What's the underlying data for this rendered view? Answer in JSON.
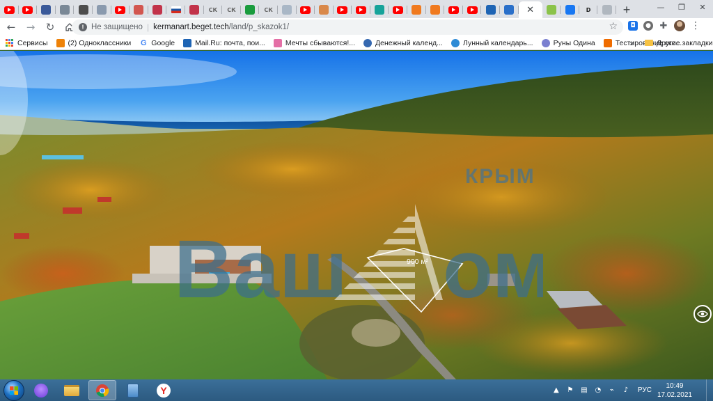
{
  "browser": {
    "tabs": [
      {
        "icon": "youtube-icon",
        "kind": "yt"
      },
      {
        "icon": "youtube-icon",
        "kind": "yt"
      },
      {
        "icon": "square-blue-icon",
        "kind": "sq",
        "color": "#3b5a9a"
      },
      {
        "icon": "mountain-icon",
        "kind": "sq",
        "color": "#7a8896"
      },
      {
        "icon": "image-icon",
        "kind": "sq",
        "color": "#4d4d4d"
      },
      {
        "icon": "link-icon",
        "kind": "sq",
        "color": "#8a9aae"
      },
      {
        "icon": "youtube-icon",
        "kind": "yt"
      },
      {
        "icon": "apple-icon",
        "kind": "sq",
        "color": "#d2564f"
      },
      {
        "icon": "star-icon",
        "kind": "sq",
        "color": "#c2334a"
      },
      {
        "icon": "russia-flag-icon",
        "kind": "flag"
      },
      {
        "icon": "star-icon",
        "kind": "sq",
        "color": "#c2334a"
      },
      {
        "icon": "ok-icon",
        "kind": "txt",
        "text": "СК",
        "color": "#666666"
      },
      {
        "icon": "ok-icon",
        "kind": "txt",
        "text": "СК",
        "color": "#666666"
      },
      {
        "icon": "plus-green-icon",
        "kind": "sq",
        "color": "#1a9c3e"
      },
      {
        "icon": "ok-icon",
        "kind": "txt",
        "text": "СК",
        "color": "#666666"
      },
      {
        "icon": "document-icon",
        "kind": "sq",
        "color": "#a9b7c6"
      },
      {
        "icon": "youtube-icon",
        "kind": "yt"
      },
      {
        "icon": "face-icon",
        "kind": "sq",
        "color": "#d9884a"
      },
      {
        "icon": "youtube-icon",
        "kind": "yt"
      },
      {
        "icon": "youtube-icon",
        "kind": "yt"
      },
      {
        "icon": "ok-teal-icon",
        "kind": "sq",
        "color": "#16a39a"
      },
      {
        "icon": "youtube-icon",
        "kind": "yt"
      },
      {
        "icon": "orange-circle-icon",
        "kind": "sq",
        "color": "#f07a1f"
      },
      {
        "icon": "orange-circle-icon",
        "kind": "sq",
        "color": "#f07a1f"
      },
      {
        "icon": "youtube-icon",
        "kind": "yt"
      },
      {
        "icon": "youtube-icon",
        "kind": "yt"
      },
      {
        "icon": "mailru-icon",
        "kind": "sq",
        "color": "#1e64b4"
      },
      {
        "icon": "mail-icon",
        "kind": "sq",
        "color": "#2a6fc9"
      },
      {
        "icon": "close-icon",
        "kind": "active"
      },
      {
        "icon": "colorful-icon",
        "kind": "sq",
        "color": "#8bc34a"
      },
      {
        "icon": "facebook-icon",
        "kind": "sq",
        "color": "#1877f2"
      },
      {
        "icon": "d-icon",
        "kind": "txt",
        "text": "D",
        "color": "#222222"
      },
      {
        "icon": "triangle-icon",
        "kind": "sq",
        "color": "#b0b7bf"
      }
    ],
    "new_tab_label": "+",
    "window": {
      "minimize": "—",
      "restore": "❐",
      "close": "✕"
    },
    "secure_label": "Не защищено",
    "url_host": "kermanart.beget.tech",
    "url_path": "/land/p_skazok1/",
    "bookmarks": [
      {
        "label": "Сервисы",
        "icon": "apps-icon"
      },
      {
        "label": "(2) Одноклассники",
        "icon": "ok-orange-icon",
        "color": "#ee8208"
      },
      {
        "label": "Google",
        "icon": "google-icon",
        "color": "#4285f4"
      },
      {
        "label": "Mail.Ru: почта, пои...",
        "icon": "mailru-icon",
        "color": "#1e64b4"
      },
      {
        "label": "Мечты сбываются!...",
        "icon": "cake-icon",
        "color": "#e46fa6"
      },
      {
        "label": "Денежный календ...",
        "icon": "globe-icon",
        "color": "#3568b0"
      },
      {
        "label": "Лунный календарь...",
        "icon": "moon-icon",
        "color": "#2e8bd6"
      },
      {
        "label": "Руны Одина",
        "icon": "rune-icon",
        "color": "#7a7fd0"
      },
      {
        "label": "Тестирование ско...",
        "icon": "speedtest-icon",
        "color": "#ef6c00"
      }
    ],
    "bookmarks_more": "»",
    "other_bookmarks": "Другие закладки"
  },
  "page": {
    "logo_text": "Ваш",
    "logo_suffix": "ом",
    "logo_crimea": "КРЫМ",
    "plot_label": "900 м²",
    "view_mode": "eye-icon"
  },
  "taskbar": {
    "language": "РУС",
    "time": "10:49",
    "date": "17.02.2021",
    "apps": [
      "alice-icon",
      "file-explorer-icon",
      "chrome-icon",
      "calculator-icon",
      "yandex-browser-icon"
    ]
  }
}
